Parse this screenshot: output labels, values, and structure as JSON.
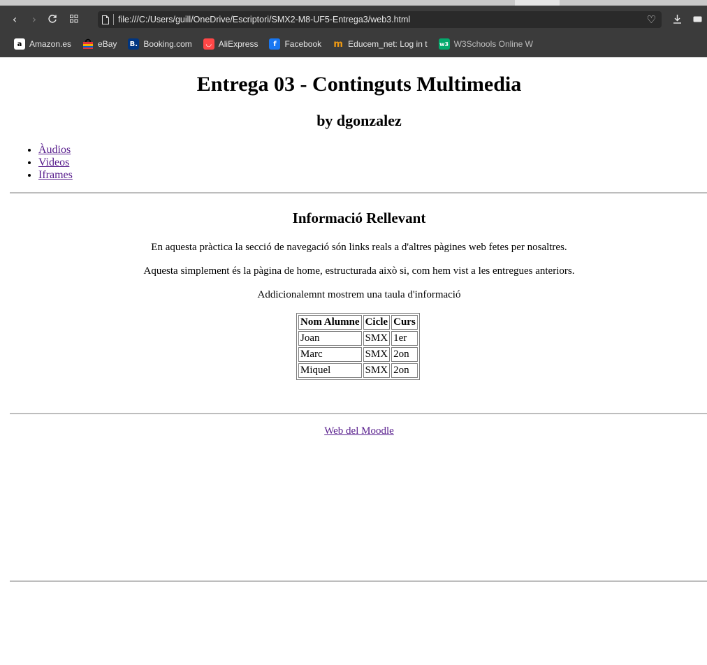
{
  "browser": {
    "url": "file:///C:/Users/guill/OneDrive/Escriptori/SMX2-M8-UF5-Entrega3/web3.html",
    "nav_icons": [
      "back-icon",
      "forward-icon",
      "reload-icon",
      "grid-icon"
    ],
    "bookmarks": [
      {
        "label": "Amazon.es",
        "icon": "a",
        "icon_bg": "#ffffff",
        "icon_fg": "#000000"
      },
      {
        "label": "eBay",
        "icon": "",
        "icon_bg": "#e53238",
        "icon_fg": "#ffffff"
      },
      {
        "label": "Booking.com",
        "icon": "B.",
        "icon_bg": "#003580",
        "icon_fg": "#ffffff"
      },
      {
        "label": "AliExpress",
        "icon": "◡",
        "icon_bg": "#ff4747",
        "icon_fg": "#ffffff"
      },
      {
        "label": "Facebook",
        "icon": "f",
        "icon_bg": "#1877f2",
        "icon_fg": "#ffffff"
      },
      {
        "label": "Educem_net: Log in t",
        "icon": "m",
        "icon_bg": "#3b3b3b",
        "icon_fg": "#f39c12"
      },
      {
        "label": "W3Schools Online W",
        "icon": "w3",
        "icon_bg": "#04aa6d",
        "icon_fg": "#ffffff"
      }
    ]
  },
  "page": {
    "title": "Entrega 03 - Continguts Multimedia",
    "subtitle": "by dgonzalez",
    "nav_links": [
      "Àudios",
      "Videos",
      "Iframes"
    ],
    "section_title": "Informació Rellevant",
    "paragraphs": [
      "En aquesta pràctica la secció de navegació són links reals a d'altres pàgines web fetes per nosaltres.",
      "Aquesta simplement és la pàgina de home, estructurada això si, com hem vist a les entregues anteriors.",
      "Addicionalemnt mostrem una taula d'informació"
    ],
    "table": {
      "headers": [
        "Nom Alumne",
        "Cicle",
        "Curs"
      ],
      "rows": [
        [
          "Joan",
          "SMX",
          "1er"
        ],
        [
          "Marc",
          "SMX",
          "2on"
        ],
        [
          "Miquel",
          "SMX",
          "2on"
        ]
      ]
    },
    "footer_link": "Web del Moodle",
    "link_color": "#551a8b"
  }
}
